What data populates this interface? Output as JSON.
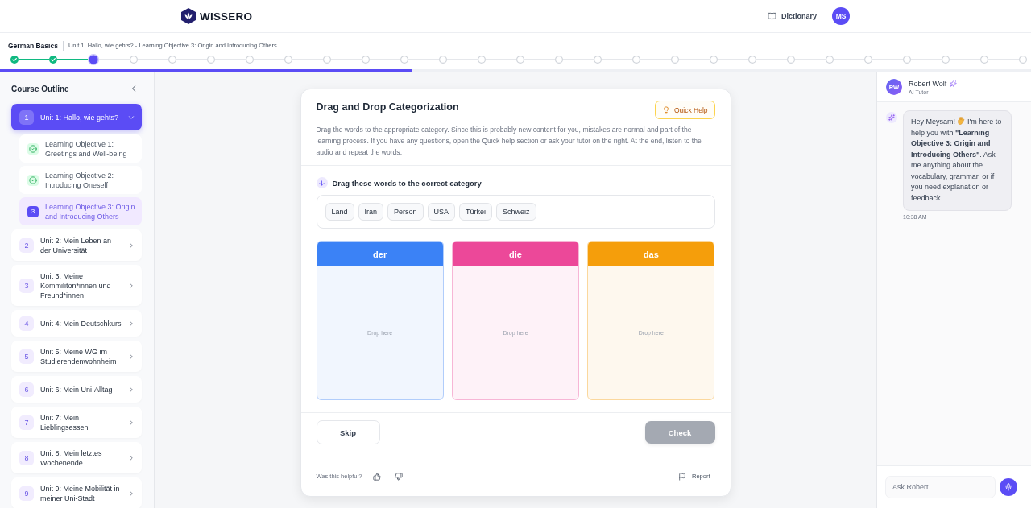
{
  "header": {
    "logo_text": "WISSERO",
    "dictionary_label": "Dictionary",
    "user_initials": "MS"
  },
  "course_bar": {
    "course_title": "German Basics",
    "breadcrumb": "Unit 1: Hallo, wie gehts? - Learning Objective 3: Origin and Introducing Others",
    "steps": [
      {
        "completed": true,
        "selected": false
      },
      {
        "completed": true,
        "selected": false
      },
      {
        "completed": false,
        "selected": true
      },
      {
        "completed": false,
        "selected": false
      },
      {
        "completed": false,
        "selected": false
      },
      {
        "completed": false,
        "selected": false
      },
      {
        "completed": false,
        "selected": false
      },
      {
        "completed": false,
        "selected": false
      },
      {
        "completed": false,
        "selected": false
      },
      {
        "completed": false,
        "selected": false
      },
      {
        "completed": false,
        "selected": false
      },
      {
        "completed": false,
        "selected": false
      },
      {
        "completed": false,
        "selected": false
      },
      {
        "completed": false,
        "selected": false
      },
      {
        "completed": false,
        "selected": false
      },
      {
        "completed": false,
        "selected": false
      },
      {
        "completed": false,
        "selected": false
      },
      {
        "completed": false,
        "selected": false
      },
      {
        "completed": false,
        "selected": false
      },
      {
        "completed": false,
        "selected": false
      },
      {
        "completed": false,
        "selected": false
      },
      {
        "completed": false,
        "selected": false
      },
      {
        "completed": false,
        "selected": false
      },
      {
        "completed": false,
        "selected": false
      },
      {
        "completed": false,
        "selected": false
      },
      {
        "completed": false,
        "selected": false
      },
      {
        "completed": false,
        "selected": false
      }
    ],
    "progress": {
      "level": 0.4
    }
  },
  "sidebar": {
    "title": "Course Outline",
    "units": [
      {
        "number": "1",
        "title": "Unit 1: Hallo, wie gehts?",
        "selected": true,
        "expanded": true,
        "objectives": [
          {
            "title": "Learning Objective 1: Greetings and Well-being",
            "completed": true,
            "selected": false
          },
          {
            "title": "Learning Objective 2: Introducing Oneself",
            "completed": true,
            "selected": false
          },
          {
            "number": "3",
            "title": "Learning Objective 3: Origin and Introducing Others",
            "completed": false,
            "selected": true
          }
        ]
      },
      {
        "number": "2",
        "title": "Unit 2: Mein Leben an der Universität",
        "selected": false,
        "expanded": false
      },
      {
        "number": "3",
        "title": "Unit 3: Meine Kommiliton*innen und Freund*innen",
        "selected": false,
        "expanded": false
      },
      {
        "number": "4",
        "title": "Unit 4: Mein Deutschkurs",
        "selected": false,
        "expanded": false
      },
      {
        "number": "5",
        "title": "Unit 5: Meine WG im Studierendenwohnheim",
        "selected": false,
        "expanded": false
      },
      {
        "number": "6",
        "title": "Unit 6: Mein Uni-Alltag",
        "selected": false,
        "expanded": false
      },
      {
        "number": "7",
        "title": "Unit 7: Mein Lieblingsessen",
        "selected": false,
        "expanded": false
      },
      {
        "number": "8",
        "title": "Unit 8: Mein letztes Wochenende",
        "selected": false,
        "expanded": false
      },
      {
        "number": "9",
        "title": "Unit 9: Meine Mobilität in meiner Uni-Stadt",
        "selected": false,
        "expanded": false
      }
    ]
  },
  "exercise": {
    "title": "Drag and Drop Categorization",
    "quick_help_label": "Quick Help",
    "instructions": "Drag the words to the appropriate category. Since this is probably new content for you, mistakes are normal and part of the learning process. If you have any questions, open the Quick help section or ask your tutor on the right. At the end, listen to the audio and repeat the words.",
    "prompt": "Drag these words to the correct category",
    "words": [
      "Land",
      "Iran",
      "Person",
      "USA",
      "Türkei",
      "Schweiz"
    ],
    "categories": [
      {
        "label": "der",
        "color": "#3b82f6",
        "hint": "Drop here"
      },
      {
        "label": "die",
        "color": "#ec4899",
        "hint": "Drop here"
      },
      {
        "label": "das",
        "color": "#f59e0b",
        "hint": "Drop here"
      }
    ],
    "skip_label": "Skip",
    "check": {
      "label": "Check",
      "disabled": true
    },
    "feedback_prompt": "Was this helpful?",
    "report_label": "Report"
  },
  "chat": {
    "tutor_initials": "RW",
    "tutor_name": "Robert Wolf",
    "tutor_role": "AI Tutor",
    "messages": [
      {
        "greeting": "Hey Meysam!",
        "text": "I'm here to help you with **\"Learning Objective 3: Origin and Introducing Others\"**. Ask me anything about the vocabulary, grammar, or if you need explanation or feedback.",
        "time": "10:38 AM"
      }
    ],
    "input": {
      "placeholder": "Ask Robert..."
    }
  }
}
